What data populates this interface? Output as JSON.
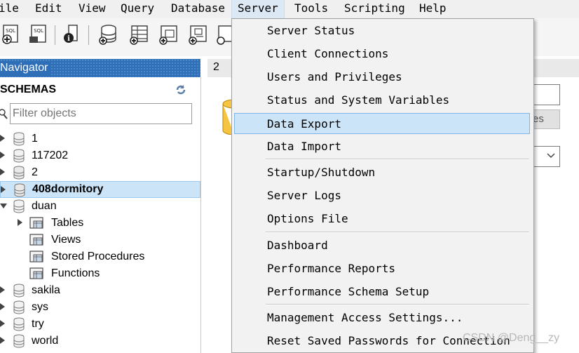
{
  "menubar": {
    "items": [
      {
        "label": "ile"
      },
      {
        "label": "Edit"
      },
      {
        "label": "View"
      },
      {
        "label": "Query"
      },
      {
        "label": "Database"
      },
      {
        "label": "Server"
      },
      {
        "label": "Tools"
      },
      {
        "label": "Scripting"
      },
      {
        "label": "Help"
      }
    ],
    "active": "Server"
  },
  "toolbar": {
    "icons": [
      "new-sql-tab-icon",
      "open-sql-script-icon",
      "inspect-icon",
      "create-schema-icon",
      "create-table-icon",
      "create-view-icon",
      "create-procedure-icon",
      "create-function-icon"
    ]
  },
  "navigator": {
    "title": "Navigator",
    "schemas_label": "SCHEMAS",
    "filter_placeholder": "Filter objects",
    "tree": [
      {
        "label": "1",
        "expanded": false
      },
      {
        "label": "117202",
        "expanded": false
      },
      {
        "label": "2",
        "expanded": false
      },
      {
        "label": "408dormitory",
        "expanded": false,
        "selected": true,
        "bold": true
      },
      {
        "label": "duan",
        "expanded": true
      },
      {
        "label": "Tables",
        "child": true,
        "expandable": true
      },
      {
        "label": "Views",
        "child": true
      },
      {
        "label": "Stored Procedures",
        "child": true
      },
      {
        "label": "Functions",
        "child": true
      },
      {
        "label": "sakila",
        "expanded": false
      },
      {
        "label": "sys",
        "expanded": false
      },
      {
        "label": "try",
        "expanded": false
      },
      {
        "label": "world",
        "expanded": false
      }
    ]
  },
  "editor": {
    "tab_label": "2",
    "button_fragment": "es"
  },
  "server_menu": {
    "groups": [
      [
        "Server Status",
        "Client Connections",
        "Users and Privileges",
        "Status and System Variables",
        "Data Export",
        "Data Import"
      ],
      [
        "Startup/Shutdown",
        "Server Logs",
        "Options File"
      ],
      [
        "Dashboard",
        "Performance Reports",
        "Performance Schema Setup"
      ],
      [
        "Management Access Settings...",
        "Reset Saved Passwords for Connection"
      ]
    ],
    "highlighted": "Data Export"
  },
  "watermark": "CSDN @Deng__zy",
  "colors": {
    "nav_header": "#2f6fb7",
    "selection": "#cce4f7",
    "menu_bg": "#f2f2f2"
  }
}
